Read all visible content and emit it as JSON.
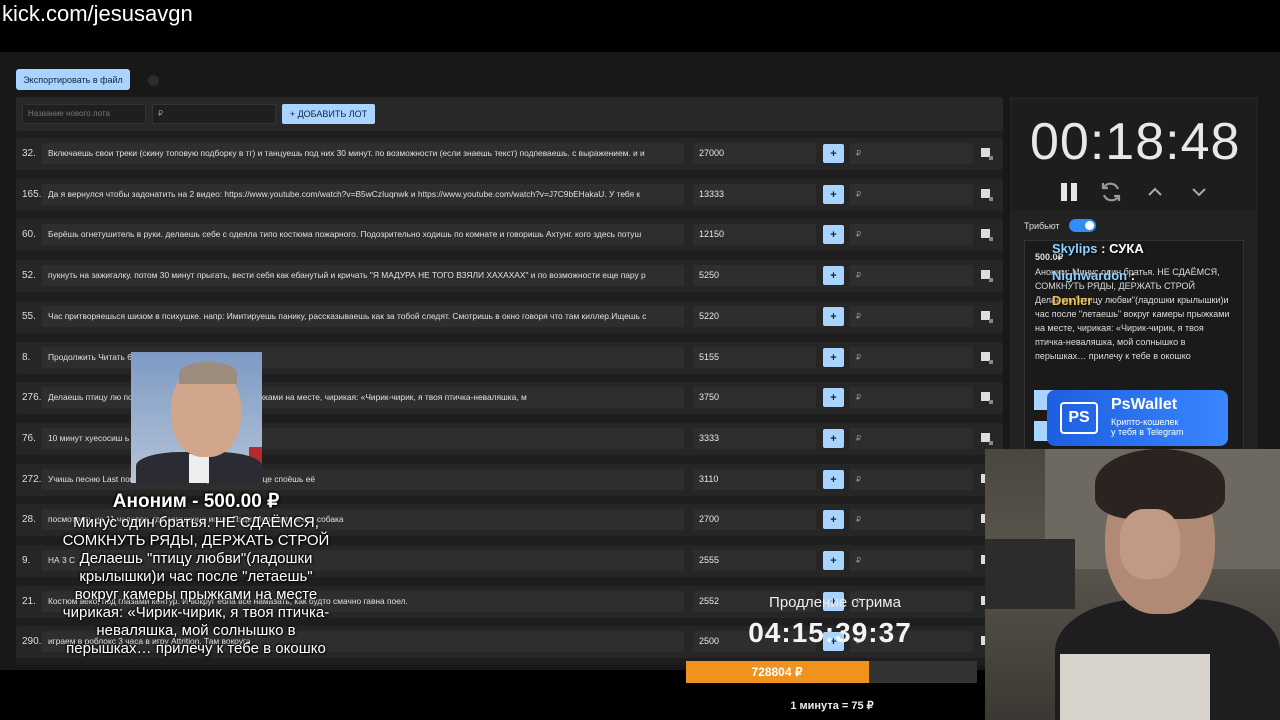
{
  "url": "kick.com/jesusavgn",
  "toolbar": {
    "export_label": "Экспортировать в файл"
  },
  "new_lot": {
    "name_placeholder": "Название нового лота",
    "price_placeholder": "₽",
    "add_label": "+ ДОБАВИТЬ ЛОТ"
  },
  "lots": [
    {
      "num": "32.",
      "desc": "Включаешь свои треки (скину топовую подборку в тг) и танцуешь под них 30 минут. по возможности (если знаешь текст) подпеваешь. с выражением. и и",
      "amount": "27000"
    },
    {
      "num": "165.",
      "desc": "Да я вернулся чтобы задонатить на 2 видео: https://www.youtube.com/watch?v=B5wCzIuqnwk и https://www.youtube.com/watch?v=J7C9bEHakaU. У тебя к",
      "amount": "13333"
    },
    {
      "num": "60.",
      "desc": "Берёшь огнетушитель в руки. делаешь себе с одеяла типо костюма пожарного. Подозрительно ходишь по комнате и говоришь Ахтунг. кого здесь потуш",
      "amount": "12150"
    },
    {
      "num": "52.",
      "desc": "пукнуть на зажигалку. потом 30 минут прыгать, вести себя как ебанутый и кричать \"Я МАДУРА НЕ ТОГО ВЗЯЛИ ХАХАХАХ\" и по возможности еще пару р",
      "amount": "5250"
    },
    {
      "num": "55.",
      "desc": "Час притворяешься шизом в психушке. напр: Имитируешь панику, рассказываешь как за тобой следят. Смотришь в окно говоря что там киллер.Ищешь с",
      "amount": "5220"
    },
    {
      "num": "8.",
      "desc": "Продолжить Читать 6",
      "amount": "5155"
    },
    {
      "num": "276.",
      "desc": "Делаешь птицу лю                             после летаешь вокруг камеры прыжками на месте, чирикая: «Чирик-чирик, я твоя птичка-неваляшка, м",
      "amount": "3750"
    },
    {
      "num": "76.",
      "desc": "10 минут хуесосиш                                                    ь с позором, несмотря на таймер",
      "amount": "3333"
    },
    {
      "num": "272.",
      "desc": "Учишь песню Last                                                                   пока полностью не выучишь, а в конце споёшь её",
      "amount": "3110"
    },
    {
      "num": "28.",
      "desc": "посмотреть                                                              из 11 человек, где загадочно исчез Пэди Мориарти и его собака",
      "amount": "2700"
    },
    {
      "num": "9.",
      "desc": "НА 3 С",
      "amount": "2555"
    },
    {
      "num": "21.",
      "desc": "Костюм                                                              веко, под глазами контур. И вокруг ебла все намазать, как будто смачно гавна поел.",
      "amount": "2552"
    },
    {
      "num": "290.",
      "desc": "играем в роблокс 3 часа в игру Attrition. Там вокруга",
      "amount": "2500"
    }
  ],
  "timer": "00:18:48",
  "tribute_label": "Трибьют",
  "card": {
    "amount": "500.0₽",
    "text": "Аноним: Минус один братья. НЕ СДАЁМСЯ, СОМКНУТЬ РЯДЫ, ДЕРЖАТЬ СТРОЙ Делаешь \"птицу любви\"(ладошки крылышки)и час после \"летаешь\" вокруг камеры прыжками на месте, чирикая: «Чирик-чирик, я твоя птичка-неваляшка, мой солнышко в перышках… прилечу к тебе в окошко"
  },
  "chat": [
    {
      "user": "Skylips",
      "msg": "СУКА",
      "color": "#8fd1ff"
    },
    {
      "user": "Nighwardon",
      "msg": "",
      "color": "#8fd1ff"
    },
    {
      "user": "Denler",
      "msg": "",
      "color": "#f2c14e"
    }
  ],
  "ad": {
    "logo": "PS",
    "title": "PsWallet",
    "sub1": "Крипто-кошелек",
    "sub2": "у тебя в Telegram"
  },
  "donation": {
    "name": "Аноним - 500.00 ₽",
    "lines": [
      "Минус один братья. НЕ СДАЁМСЯ,",
      "СОМКНУТЬ РЯДЫ, ДЕРЖАТЬ СТРОЙ",
      "Делаешь \"птицу любви\"(ладошки",
      "крылышки)и час после \"летаешь\"",
      "вокруг камеры прыжками на месте",
      "чирикая: «Чирик-чирик, я твоя птичка-",
      "неваляшка, мой солнышко в",
      "перышках… прилечу к тебе в окошко"
    ]
  },
  "extension": {
    "label": "Продление стрима",
    "timer": "04:15:39:37",
    "collected": "728804 ₽",
    "progress_fraction": 0.63,
    "rate": "1 минута = 75 ₽"
  },
  "colors": {
    "accent": "#a9d4ff",
    "orange": "#f0921e",
    "toggle": "#2f8df5"
  }
}
